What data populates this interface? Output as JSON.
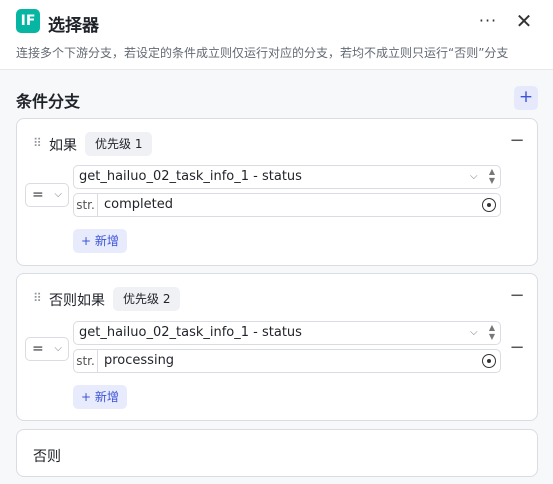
{
  "header": {
    "badge": "IF",
    "title": "选择器",
    "more_icon": "more-horizontal-icon",
    "close_icon": "close-icon",
    "description": "连接多个下游分支，若设定的条件成立则仅运行对应的分支，若均不成立则只运行“否则”分支"
  },
  "section": {
    "title": "条件分支",
    "add_label": "+"
  },
  "branches": [
    {
      "label": "如果",
      "priority": "优先级 1",
      "condition": {
        "operator": "=",
        "variable": "get_hailuo_02_task_info_1",
        "separator": " - ",
        "field": "status",
        "value_type": "str.",
        "value": "completed"
      },
      "add_label": "+ 新增"
    },
    {
      "label": "否则如果",
      "priority": "优先级 2",
      "condition": {
        "operator": "=",
        "variable": "get_hailuo_02_task_info_1",
        "separator": " - ",
        "field": "status",
        "value_type": "str.",
        "value": "processing"
      },
      "add_label": "+ 新增"
    }
  ],
  "else_branch": {
    "label": "否则"
  },
  "colors": {
    "accent": "#3b53d9",
    "badge": "#06b6a3"
  }
}
